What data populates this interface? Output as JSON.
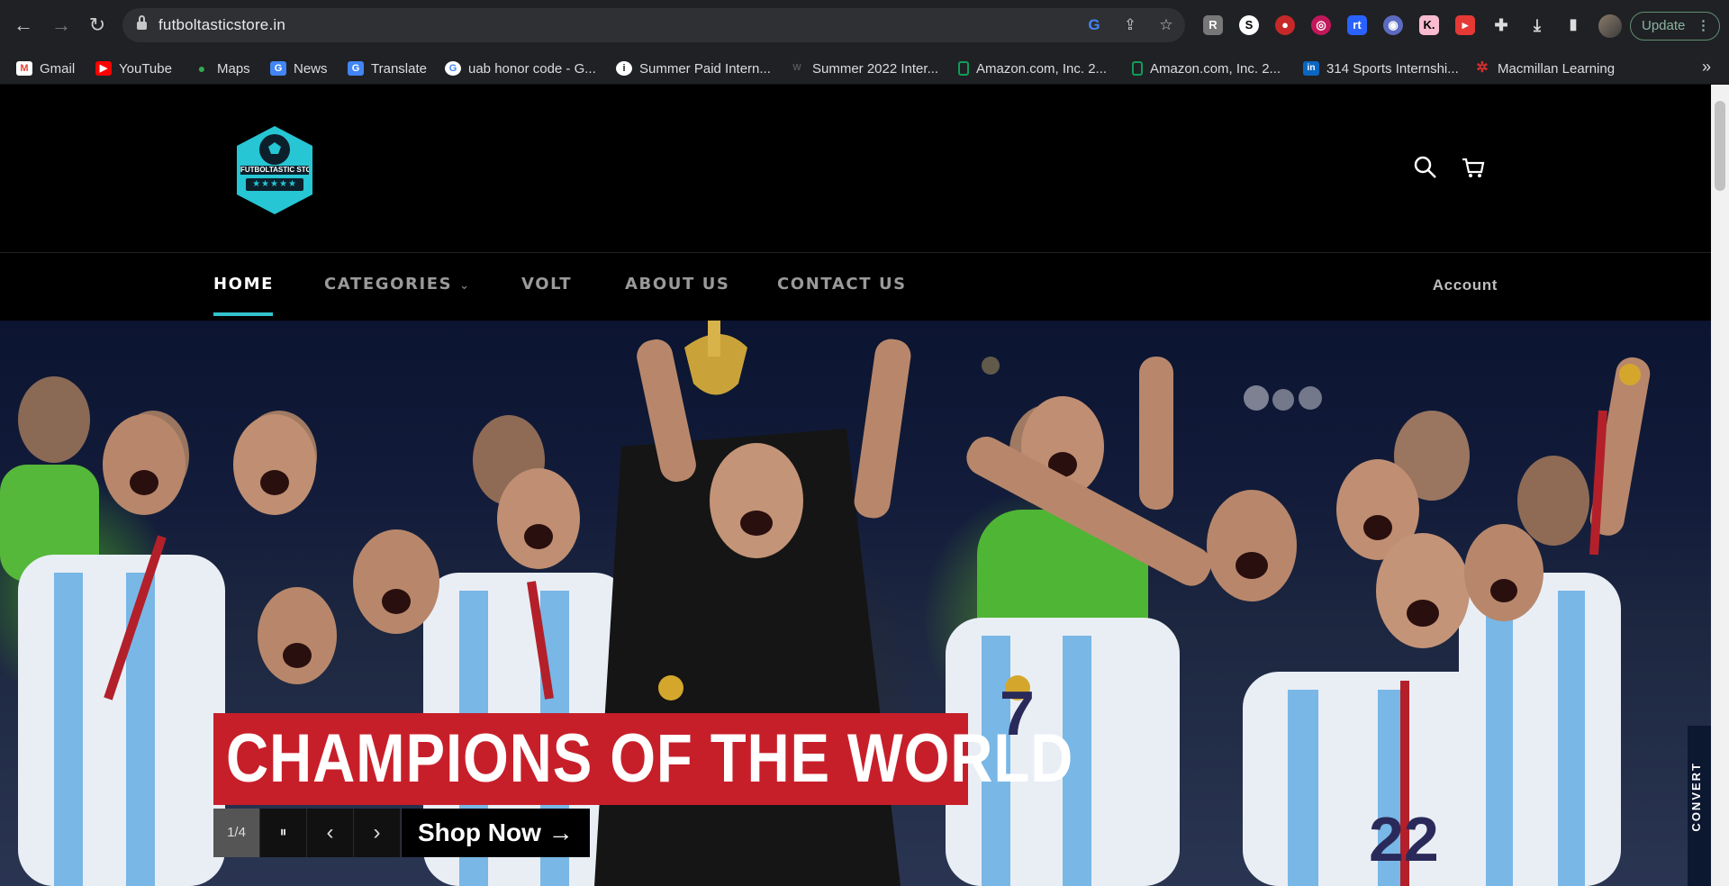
{
  "browser": {
    "url": "futboltasticstore.in",
    "update_label": "Update",
    "update_menu": "⋮",
    "bookmarks": [
      {
        "label": "Gmail",
        "icon": "gmail-icon",
        "color": "#ea4335",
        "glyph": "M"
      },
      {
        "label": "YouTube",
        "icon": "youtube-icon",
        "color": "#ff0000",
        "glyph": "▶"
      },
      {
        "label": "Maps",
        "icon": "maps-icon",
        "color": "#34a853",
        "glyph": "●"
      },
      {
        "label": "News",
        "icon": "news-icon",
        "color": "#4285f4",
        "glyph": "G"
      },
      {
        "label": "Translate",
        "icon": "translate-icon",
        "color": "#4285f4",
        "glyph": "G"
      },
      {
        "label": "uab honor code - G...",
        "icon": "google-icon",
        "color": "#ffffff",
        "glyph": "G"
      },
      {
        "label": "Summer Paid Intern...",
        "icon": "info-icon",
        "color": "#ffffff",
        "glyph": "i"
      },
      {
        "label": "Summer 2022 Inter...",
        "icon": "wm-icon",
        "color": "#202124",
        "glyph": "W"
      },
      {
        "label": "Amazon.com, Inc. 2...",
        "icon": "sheet-icon",
        "color": "#0f9d58",
        "glyph": ""
      },
      {
        "label": "Amazon.com, Inc. 2...",
        "icon": "sheet-icon",
        "color": "#0f9d58",
        "glyph": ""
      },
      {
        "label": "314 Sports Internshi...",
        "icon": "linkedin-icon",
        "color": "#0a66c2",
        "glyph": "in"
      },
      {
        "label": "Macmillan Learning",
        "icon": "macmillan-icon",
        "color": "#d32f2f",
        "glyph": "✲"
      }
    ],
    "bookmarks_more": "»"
  },
  "site": {
    "logo_text": "FUTBOLTASTIC STORE",
    "logo_stars": "★★★★★",
    "nav": [
      {
        "label": "HOME",
        "active": true
      },
      {
        "label": "CATEGORIES",
        "dropdown": "⌄"
      },
      {
        "label": "VOLT"
      },
      {
        "label": "ABOUT US"
      },
      {
        "label": "CONTACT US"
      }
    ],
    "account_label": "Account",
    "accent_color": "#33c3cc"
  },
  "hero": {
    "title": "CHAMPIONS OF THE WORLD",
    "slide_counter": "1/4",
    "pause_glyph": "⏸",
    "prev_glyph": "‹",
    "next_glyph": "›",
    "shop_now": "Shop Now →",
    "title_bg": "#c71f2a",
    "convert_label": "CONVERT"
  }
}
